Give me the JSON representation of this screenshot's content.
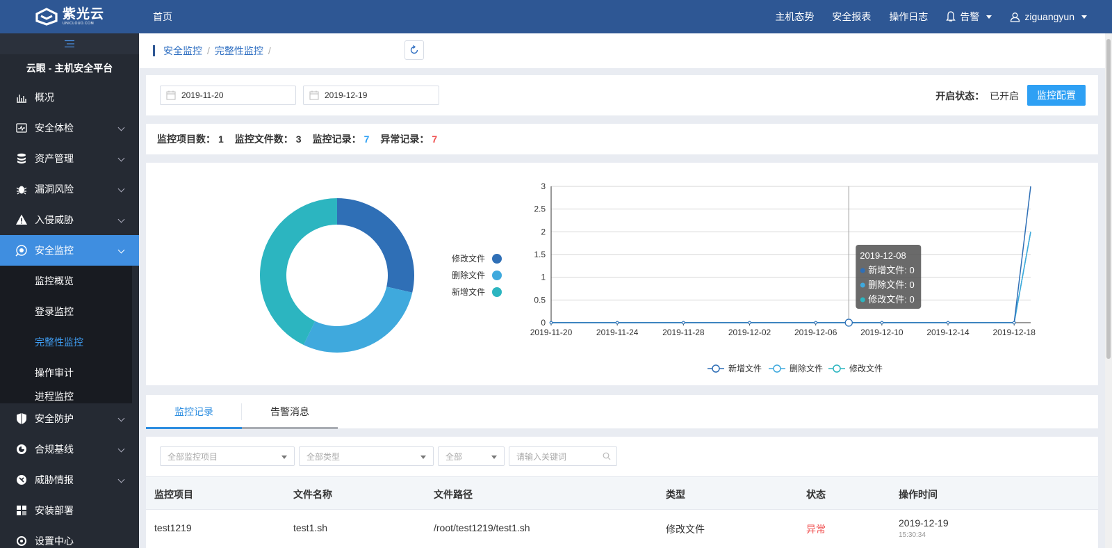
{
  "app": {
    "logo_cn": "紫光云",
    "logo_en": "UNICLOUD.COM",
    "home": "首页",
    "platform_title": "云眼 - 主机安全平台"
  },
  "topnav": {
    "items": [
      "主机态势",
      "安全报表",
      "操作日志"
    ],
    "alarm": "告警",
    "user": "ziguangyun"
  },
  "sidebar": {
    "items": [
      {
        "label": "概况",
        "icon": "chart-icon"
      },
      {
        "label": "安全体检",
        "icon": "checkup-icon"
      },
      {
        "label": "资产管理",
        "icon": "database-icon"
      },
      {
        "label": "漏洞风险",
        "icon": "bug-icon"
      },
      {
        "label": "入侵威胁",
        "icon": "warning-icon"
      },
      {
        "label": "安全监控",
        "icon": "monitor-icon"
      }
    ],
    "submenu": [
      "监控概览",
      "登录监控",
      "完整性监控",
      "操作审计",
      "进程监控"
    ],
    "items_after": [
      {
        "label": "安全防护",
        "icon": "shield-icon"
      },
      {
        "label": "合规基线",
        "icon": "baseline-icon"
      },
      {
        "label": "威胁情报",
        "icon": "intel-icon"
      },
      {
        "label": "安装部署",
        "icon": "deploy-icon"
      },
      {
        "label": "设置中心",
        "icon": "settings-icon"
      }
    ]
  },
  "breadcrumb": [
    "安全监控",
    "完整性监控"
  ],
  "filter": {
    "start_date": "2019-11-20",
    "end_date": "2019-12-19",
    "status_label": "开启状态：",
    "status_value": "已开启",
    "config_button": "监控配置"
  },
  "stats": {
    "items_label": "监控项目数：",
    "items_value": "1",
    "files_label": "监控文件数：",
    "files_value": "3",
    "records_label": "监控记录：",
    "records_value": "7",
    "abnormal_label": "异常记录：",
    "abnormal_value": "7"
  },
  "chart_data": [
    {
      "type": "pie",
      "donut": true,
      "categories": [
        "修改文件",
        "删除文件",
        "新增文件"
      ],
      "values": [
        2,
        2,
        3
      ],
      "colors": [
        "#2f6fb6",
        "#3fa9dd",
        "#2cb5c0"
      ],
      "legend": "right"
    },
    {
      "type": "line",
      "x": [
        "2019-11-20",
        "2019-11-22",
        "2019-11-24",
        "2019-11-26",
        "2019-11-28",
        "2019-11-30",
        "2019-12-02",
        "2019-12-04",
        "2019-12-06",
        "2019-12-08",
        "2019-12-10",
        "2019-12-12",
        "2019-12-14",
        "2019-12-16",
        "2019-12-18",
        "2019-12-19"
      ],
      "x_tick_labels": [
        "2019-11-20",
        "2019-11-24",
        "2019-11-28",
        "2019-12-02",
        "2019-12-06",
        "2019-12-10",
        "2019-12-14",
        "2019-12-18"
      ],
      "y_ticks": [
        "0",
        "0.5",
        "1",
        "1.5",
        "2",
        "2.5",
        "3"
      ],
      "ylim": [
        0,
        3
      ],
      "series": [
        {
          "name": "新增文件",
          "color": "#2f6fb6",
          "values": [
            0,
            0,
            0,
            0,
            0,
            0,
            0,
            0,
            0,
            0,
            0,
            0,
            0,
            0,
            0,
            3
          ]
        },
        {
          "name": "删除文件",
          "color": "#3fa9dd",
          "values": [
            0,
            0,
            0,
            0,
            0,
            0,
            0,
            0,
            0,
            0,
            0,
            0,
            0,
            0,
            0,
            2
          ]
        },
        {
          "name": "修改文件",
          "color": "#2cb5c0",
          "values": [
            0,
            0,
            0,
            0,
            0,
            0,
            0,
            0,
            0,
            0,
            0,
            0,
            0,
            0,
            0,
            2
          ]
        }
      ],
      "grid": true,
      "legend": "bottom",
      "tooltip": {
        "title": "2019-12-08",
        "rows": [
          "新增文件: 0",
          "删除文件: 0",
          "修改文件: 0"
        ]
      }
    }
  ],
  "tabs": [
    "监控记录",
    "告警消息"
  ],
  "table": {
    "filters": {
      "project_placeholder": "全部监控项目",
      "type_placeholder": "全部类型",
      "status_placeholder": "全部",
      "keyword_placeholder": "请输入关键词"
    },
    "columns": [
      "监控项目",
      "文件名称",
      "文件路径",
      "类型",
      "状态",
      "操作时间"
    ],
    "rows": [
      {
        "project": "test1219",
        "file": "test1.sh",
        "path": "/root/test1219/test1.sh",
        "type": "修改文件",
        "status": "异常",
        "date": "2019-12-19",
        "time": "15:30:34"
      }
    ]
  },
  "colors": {
    "topbar": "#2e5794",
    "sidebar": "#252a33",
    "accent": "#2ea0f4",
    "danger": "#f05050"
  }
}
